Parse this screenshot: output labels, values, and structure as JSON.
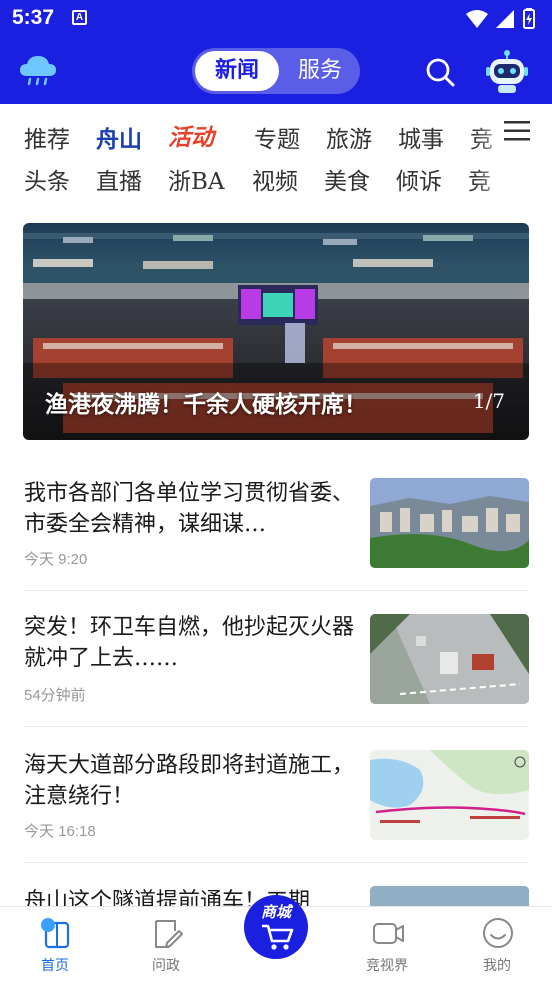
{
  "status": {
    "time": "5:37",
    "badge": "A"
  },
  "header": {
    "tabs": [
      {
        "label": "新闻",
        "active": true
      },
      {
        "label": "服务",
        "active": false
      }
    ],
    "icons": [
      "cloud-weather-icon",
      "search-icon",
      "robot-assistant-icon"
    ]
  },
  "channels": {
    "row1": [
      "推荐",
      "舟山",
      "活动",
      "专题",
      "旅游",
      "城事",
      "竞"
    ],
    "row2": [
      "头条",
      "直播",
      "浙BA",
      "视频",
      "美食",
      "倾诉",
      "竞"
    ]
  },
  "banner": {
    "caption": "渔港夜沸腾！千余人硬核开席！",
    "counter": "1/7"
  },
  "news": [
    {
      "title": "我市各部门各单位学习贯彻省委、市委全会精神，谋细谋…",
      "time": "今天  9:20"
    },
    {
      "title": "突发！环卫车自燃，他抄起灭火器就冲了上去……",
      "time": "54分钟前"
    },
    {
      "title": "海天大道部分路段即将封道施工，注意绕行！",
      "time": "今天  16:18"
    },
    {
      "title": "舟山这个隧道提前通车！工期",
      "time": ""
    }
  ],
  "bottom_nav": [
    {
      "label": "首页",
      "icon": "home-icon",
      "active": true
    },
    {
      "label": "问政",
      "icon": "petition-icon",
      "active": false
    },
    {
      "label": "商城",
      "icon": "shopping-cart-icon",
      "active": false
    },
    {
      "label": "竞视界",
      "icon": "video-camera-icon",
      "active": false
    },
    {
      "label": "我的",
      "icon": "profile-smile-icon",
      "active": false
    }
  ],
  "colors": {
    "primary": "#1a1fe0",
    "active_tab": "#1a6ee8",
    "event_red": "#e8412a"
  }
}
